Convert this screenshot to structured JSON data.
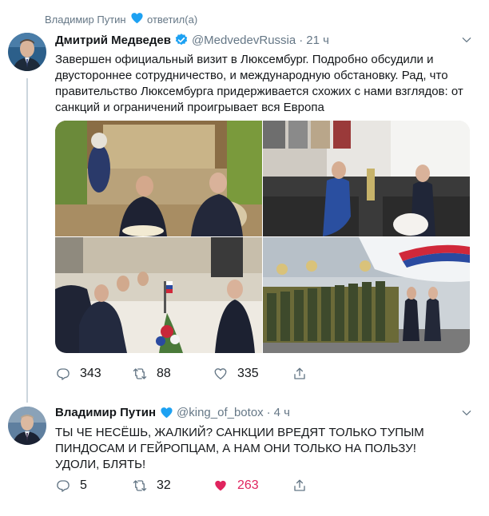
{
  "context": {
    "actor": "Владимир Путин",
    "action": "ответил(а)"
  },
  "tweet1": {
    "name": "Дмитрий Медведев",
    "handle": "@MedvedevRussia",
    "time": "21 ч",
    "text_lines": [
      "Завершен официальный визит в Люксембург. Подробно обсудили и",
      "двустороннее сотрудничество, и международную обстановку. Рад, что",
      "правительство Люксембурга придерживается схожих с нами взглядов: от",
      "санкций и ограничений проигрывает вся Европа"
    ],
    "replies": "343",
    "retweets": "88",
    "likes": "335"
  },
  "tweet2": {
    "name": "Владимир Путин",
    "handle": "@king_of_botox",
    "time": "4 ч",
    "text_lines": [
      "ТЫ ЧЕ НЕСЁШЬ, ЖАЛКИЙ? САНКЦИИ ВРЕДЯТ ТОЛЬКО ТУПЫМ",
      "ПИНДОСАМ И ГЕЙРОПЦАМ, А НАМ ОНИ ТОЛЬКО НА ПОЛЬЗУ!",
      "УДОЛИ, БЛЯТЬ!"
    ],
    "replies": "5",
    "retweets": "32",
    "likes": "263"
  },
  "colors": {
    "accent": "#1da1f2",
    "like": "#e0245e",
    "muted": "#657786"
  },
  "icons": [
    "heart-icon",
    "verified-icon",
    "chevron-down-icon",
    "reply-icon",
    "retweet-icon",
    "like-icon",
    "share-icon"
  ]
}
